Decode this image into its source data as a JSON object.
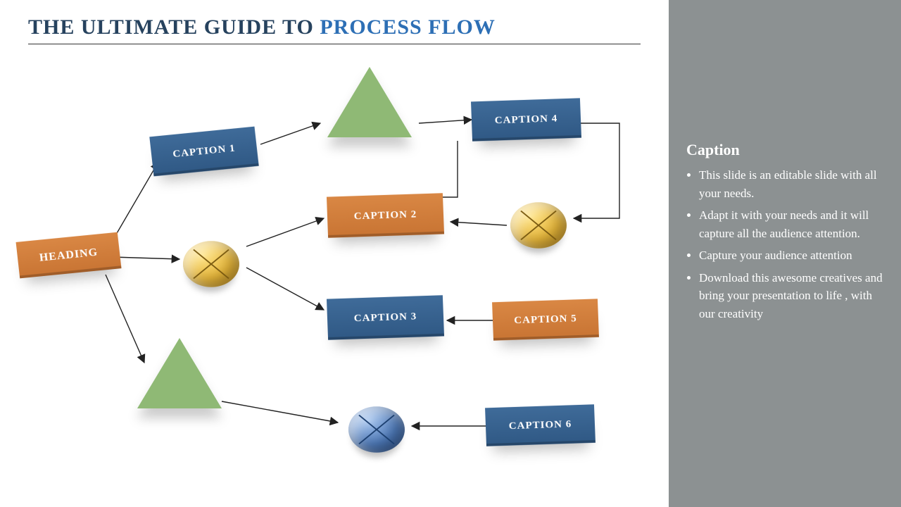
{
  "title": {
    "prefix": "THE ULTIMATE GUIDE TO ",
    "highlight": "PROCESS FLOW"
  },
  "sidebar": {
    "heading": "Caption",
    "bullets": [
      "This slide is an editable slide with all your needs.",
      "Adapt it with your needs and it will capture all the audience attention.",
      "Capture your audience attention",
      "Download this awesome creatives and bring your presentation to life , with our creativity"
    ]
  },
  "nodes": {
    "heading": "HEADING",
    "caption1": "CAPTION 1",
    "caption2": "CAPTION 2",
    "caption3": "CAPTION 3",
    "caption4": "CAPTION 4",
    "caption5": "CAPTION 5",
    "caption6": "CAPTION 6"
  }
}
